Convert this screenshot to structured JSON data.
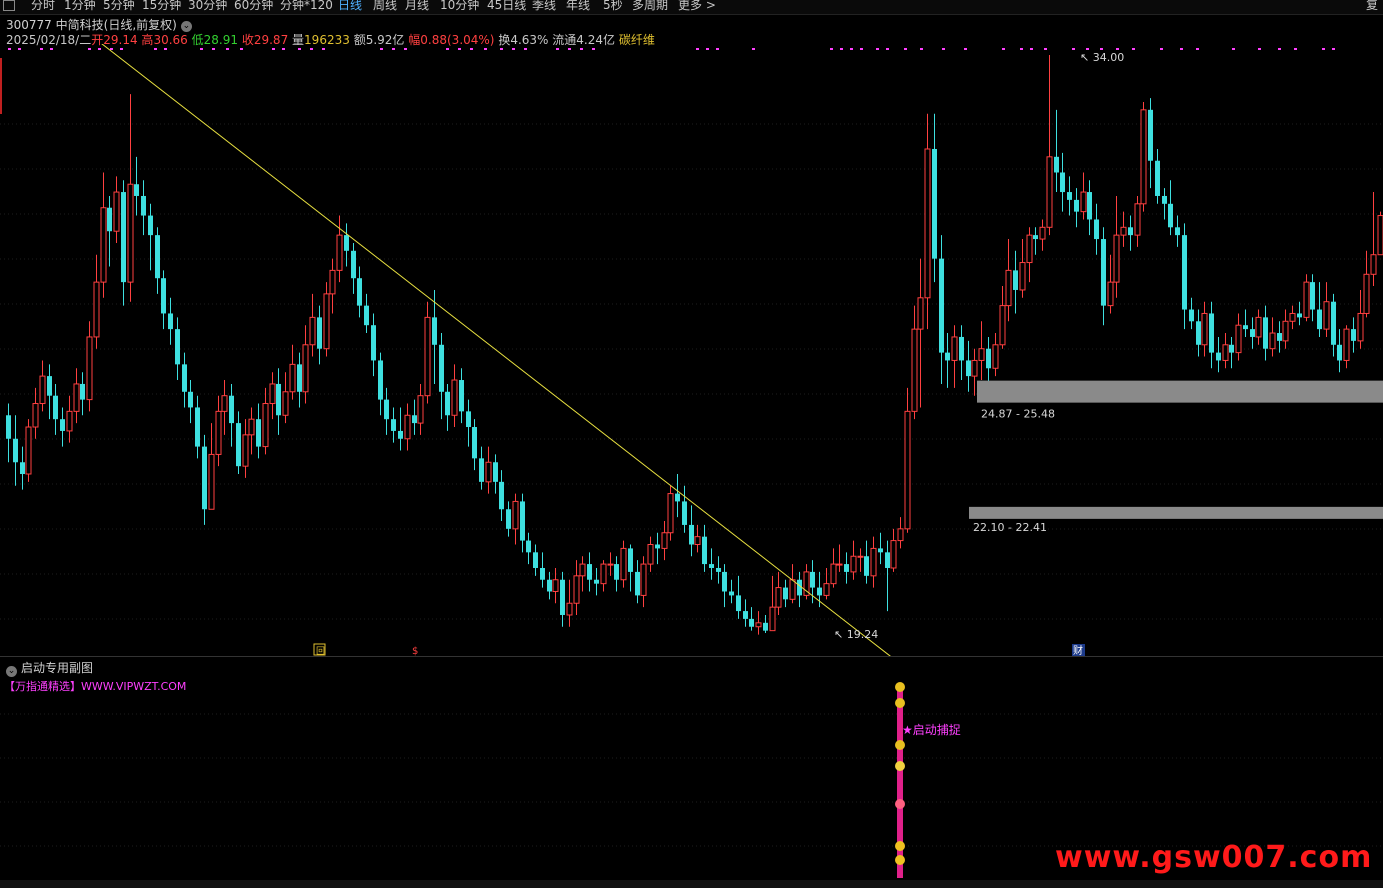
{
  "toolbar": {
    "items": [
      "分时",
      "1分钟",
      "5分钟",
      "15分钟",
      "30分钟",
      "60分钟",
      "分钟*120",
      "日线",
      "周线",
      "月线",
      "10分钟",
      "45日线",
      "季线",
      "年线",
      "5秒",
      "多周期",
      "更多 >"
    ],
    "active": "日线",
    "right_label": "复"
  },
  "title": {
    "code": "300777",
    "name": "中简科技",
    "mode": "(日线,前复权)"
  },
  "info": {
    "date": "2025/02/18/二",
    "open_label": "开",
    "open": "29.14",
    "high_label": "高",
    "high": "30.66",
    "low_label": "低",
    "low": "28.91",
    "close_label": "收",
    "close": "29.87",
    "volume_label": "量",
    "volume": "196233",
    "amount_label": "额",
    "amount": "5.92亿",
    "change_label": "幅",
    "change": "0.88(3.04%)",
    "turnover_label": "换",
    "turnover": "4.63%",
    "float_label": "流通",
    "float": "4.24亿",
    "concept": "碳纤维"
  },
  "chart_data": {
    "type": "candlestick",
    "series_note": "",
    "price_range": [
      17.5,
      35.5
    ],
    "max_label": "34.00",
    "min_label": "19.24",
    "zones": [
      {
        "label": "24.87 - 25.48",
        "low": 24.87,
        "high": 25.48
      },
      {
        "label": "22.10 - 22.41",
        "low": 22.1,
        "high": 22.41
      }
    ],
    "trendline": {
      "from": 34.6,
      "to": 18.0
    },
    "markers": {
      "back": "回",
      "dollar": "$",
      "finance": "财"
    },
    "candles": [
      [
        24.8,
        24.2,
        25.1,
        23.6
      ],
      [
        24.2,
        23.6,
        24.8,
        23.0
      ],
      [
        23.6,
        23.3,
        24.0,
        22.9
      ],
      [
        23.3,
        24.5,
        24.7,
        23.1
      ],
      [
        24.5,
        25.1,
        25.5,
        24.2
      ],
      [
        25.1,
        25.8,
        26.2,
        24.9
      ],
      [
        25.8,
        25.3,
        26.1,
        24.7
      ],
      [
        25.3,
        24.7,
        25.6,
        24.3
      ],
      [
        24.7,
        24.4,
        25.0,
        24.0
      ],
      [
        24.4,
        24.9,
        25.3,
        24.1
      ],
      [
        24.9,
        25.6,
        26.0,
        24.6
      ],
      [
        25.6,
        25.2,
        25.9,
        24.8
      ],
      [
        25.2,
        26.8,
        27.2,
        24.9
      ],
      [
        26.8,
        28.2,
        28.9,
        26.5
      ],
      [
        28.2,
        30.1,
        31.0,
        27.8
      ],
      [
        30.1,
        29.5,
        30.4,
        28.6
      ],
      [
        29.5,
        30.5,
        30.9,
        29.2
      ],
      [
        30.5,
        28.2,
        30.8,
        27.6
      ],
      [
        28.2,
        30.7,
        33.0,
        27.7
      ],
      [
        30.7,
        30.4,
        31.4,
        29.9
      ],
      [
        30.4,
        29.9,
        30.8,
        29.4
      ],
      [
        29.9,
        29.4,
        30.2,
        28.5
      ],
      [
        29.4,
        28.3,
        29.6,
        27.9
      ],
      [
        28.3,
        27.4,
        28.5,
        27.0
      ],
      [
        27.4,
        27.0,
        27.8,
        26.6
      ],
      [
        27.0,
        26.1,
        27.3,
        25.7
      ],
      [
        26.1,
        25.4,
        26.4,
        25.0
      ],
      [
        25.4,
        25.0,
        25.7,
        24.6
      ],
      [
        25.0,
        24.0,
        25.3,
        23.7
      ],
      [
        24.0,
        22.4,
        24.3,
        22.0
      ],
      [
        22.4,
        23.8,
        24.6,
        22.8
      ],
      [
        23.8,
        24.9,
        25.3,
        23.5
      ],
      [
        24.9,
        25.3,
        25.7,
        24.3
      ],
      [
        25.3,
        24.6,
        25.6,
        24.0
      ],
      [
        24.6,
        23.5,
        24.9,
        23.3
      ],
      [
        23.5,
        24.3,
        24.7,
        23.2
      ],
      [
        24.3,
        24.7,
        25.0,
        23.8
      ],
      [
        24.7,
        24.0,
        25.1,
        23.7
      ],
      [
        24.0,
        25.1,
        25.5,
        23.8
      ],
      [
        25.1,
        25.6,
        25.9,
        24.7
      ],
      [
        25.6,
        24.8,
        26.0,
        24.3
      ],
      [
        24.8,
        25.4,
        25.9,
        24.6
      ],
      [
        25.4,
        26.1,
        26.6,
        25.2
      ],
      [
        26.1,
        25.4,
        26.4,
        25.0
      ],
      [
        25.4,
        26.6,
        27.1,
        25.1
      ],
      [
        26.6,
        27.3,
        27.9,
        26.3
      ],
      [
        27.3,
        26.5,
        27.6,
        26.1
      ],
      [
        26.5,
        27.9,
        28.2,
        26.3
      ],
      [
        27.9,
        28.5,
        28.8,
        27.4
      ],
      [
        28.5,
        29.4,
        29.9,
        28.2
      ],
      [
        29.4,
        29.0,
        29.7,
        28.6
      ],
      [
        29.0,
        28.3,
        29.2,
        27.9
      ],
      [
        28.3,
        27.6,
        28.6,
        27.3
      ],
      [
        27.6,
        27.1,
        27.9,
        26.9
      ],
      [
        27.1,
        26.2,
        27.4,
        25.8
      ],
      [
        26.2,
        25.2,
        26.4,
        24.8
      ],
      [
        25.2,
        24.7,
        25.5,
        24.3
      ],
      [
        24.7,
        24.4,
        25.0,
        24.1
      ],
      [
        24.4,
        24.2,
        25.0,
        23.9
      ],
      [
        24.2,
        24.8,
        25.1,
        23.9
      ],
      [
        24.8,
        24.6,
        25.2,
        24.3
      ],
      [
        24.6,
        25.3,
        25.6,
        24.3
      ],
      [
        25.3,
        27.3,
        27.7,
        25.1
      ],
      [
        27.3,
        26.6,
        28.0,
        25.6
      ],
      [
        26.6,
        25.4,
        26.9,
        24.7
      ],
      [
        25.4,
        24.8,
        25.6,
        24.4
      ],
      [
        24.8,
        25.7,
        26.1,
        24.5
      ],
      [
        25.7,
        24.9,
        26.0,
        24.6
      ],
      [
        24.9,
        24.5,
        25.2,
        24.0
      ],
      [
        24.5,
        23.7,
        24.7,
        23.4
      ],
      [
        23.7,
        23.1,
        24.0,
        22.9
      ],
      [
        23.1,
        23.6,
        24.0,
        22.8
      ],
      [
        23.6,
        23.1,
        23.8,
        22.8
      ],
      [
        23.1,
        22.4,
        23.4,
        22.1
      ],
      [
        22.4,
        21.9,
        22.6,
        21.7
      ],
      [
        21.9,
        22.6,
        22.8,
        21.5
      ],
      [
        22.6,
        21.6,
        22.8,
        21.3
      ],
      [
        21.6,
        21.3,
        21.8,
        21.0
      ],
      [
        21.3,
        20.9,
        21.5,
        20.7
      ],
      [
        20.9,
        20.6,
        21.3,
        20.4
      ],
      [
        20.6,
        20.3,
        20.8,
        20.1
      ],
      [
        20.3,
        20.6,
        20.9,
        20.0
      ],
      [
        20.6,
        19.7,
        20.8,
        19.4
      ],
      [
        19.7,
        20.0,
        20.6,
        19.4
      ],
      [
        20.0,
        20.7,
        21.1,
        19.7
      ],
      [
        20.7,
        21.0,
        21.2,
        20.3
      ],
      [
        21.0,
        20.6,
        21.3,
        20.3
      ],
      [
        20.6,
        20.5,
        20.9,
        20.2
      ],
      [
        20.5,
        21.0,
        21.1,
        20.3
      ],
      [
        21.0,
        21.0,
        21.3,
        20.7
      ],
      [
        21.0,
        20.6,
        21.2,
        20.3
      ],
      [
        20.6,
        21.4,
        21.6,
        20.4
      ],
      [
        21.4,
        20.8,
        21.5,
        20.3
      ],
      [
        20.8,
        20.2,
        21.1,
        20.0
      ],
      [
        20.2,
        21.0,
        21.2,
        19.9
      ],
      [
        21.0,
        21.5,
        21.7,
        20.8
      ],
      [
        21.5,
        21.4,
        21.8,
        21.0
      ],
      [
        21.4,
        21.8,
        22.1,
        21.1
      ],
      [
        21.8,
        22.8,
        23.0,
        21.6
      ],
      [
        22.8,
        22.6,
        23.3,
        22.2
      ],
      [
        22.6,
        22.0,
        23.0,
        21.8
      ],
      [
        22.0,
        21.5,
        22.5,
        21.2
      ],
      [
        21.5,
        21.7,
        22.0,
        21.3
      ],
      [
        21.7,
        21.0,
        22.0,
        20.8
      ],
      [
        21.0,
        20.9,
        21.4,
        20.6
      ],
      [
        20.9,
        20.8,
        21.2,
        20.5
      ],
      [
        20.8,
        20.3,
        21.0,
        19.9
      ],
      [
        20.3,
        20.2,
        20.6,
        20.0
      ],
      [
        20.2,
        19.8,
        20.7,
        19.6
      ],
      [
        19.8,
        19.6,
        20.1,
        19.4
      ],
      [
        19.6,
        19.4,
        19.9,
        19.3
      ],
      [
        19.4,
        19.5,
        19.8,
        19.2
      ],
      [
        19.5,
        19.3,
        19.7,
        19.24
      ],
      [
        19.3,
        19.9,
        20.7,
        19.3
      ],
      [
        19.9,
        20.4,
        20.8,
        19.7
      ],
      [
        20.4,
        20.1,
        20.6,
        19.9
      ],
      [
        20.1,
        20.6,
        21.0,
        20.0
      ],
      [
        20.6,
        20.2,
        20.8,
        19.9
      ],
      [
        20.2,
        20.8,
        21.0,
        20.1
      ],
      [
        20.8,
        20.4,
        21.1,
        20.0
      ],
      [
        20.4,
        20.2,
        20.8,
        19.9
      ],
      [
        20.2,
        20.5,
        20.9,
        20.1
      ],
      [
        20.5,
        21.0,
        21.4,
        20.4
      ],
      [
        21.0,
        21.0,
        21.5,
        20.8
      ],
      [
        21.0,
        20.8,
        21.3,
        20.5
      ],
      [
        20.8,
        21.2,
        21.6,
        20.6
      ],
      [
        21.2,
        21.2,
        21.4,
        20.8
      ],
      [
        21.2,
        20.7,
        21.6,
        20.5
      ],
      [
        20.7,
        21.4,
        21.7,
        20.4
      ],
      [
        21.4,
        21.3,
        21.8,
        21.0
      ],
      [
        21.3,
        20.9,
        21.6,
        19.8
      ],
      [
        20.9,
        21.6,
        21.9,
        20.8
      ],
      [
        21.6,
        21.9,
        22.2,
        21.4
      ],
      [
        21.9,
        24.9,
        25.5,
        21.8
      ],
      [
        24.9,
        27.0,
        27.6,
        24.7
      ],
      [
        27.0,
        27.8,
        28.8,
        25.0
      ],
      [
        27.8,
        31.6,
        32.5,
        27.0
      ],
      [
        31.6,
        28.8,
        32.5,
        28.2
      ],
      [
        28.8,
        26.4,
        29.4,
        25.6
      ],
      [
        26.4,
        26.2,
        26.9,
        25.5
      ],
      [
        26.2,
        26.8,
        27.1,
        25.5
      ],
      [
        26.8,
        26.2,
        27.1,
        25.7
      ],
      [
        26.2,
        25.8,
        26.7,
        25.4
      ],
      [
        25.8,
        26.2,
        26.5,
        25.3
      ],
      [
        26.2,
        26.5,
        27.2,
        25.7
      ],
      [
        26.5,
        26.0,
        26.8,
        25.5
      ],
      [
        26.0,
        26.6,
        26.9,
        25.8
      ],
      [
        26.6,
        27.6,
        28.1,
        26.5
      ],
      [
        27.6,
        28.5,
        29.3,
        27.2
      ],
      [
        28.5,
        28.0,
        29.0,
        27.4
      ],
      [
        28.0,
        28.7,
        29.3,
        27.8
      ],
      [
        28.7,
        29.4,
        29.6,
        28.2
      ],
      [
        29.4,
        29.3,
        29.6,
        28.9
      ],
      [
        29.3,
        29.6,
        29.8,
        29.0
      ],
      [
        29.6,
        31.4,
        34.0,
        29.4
      ],
      [
        31.4,
        31.0,
        32.6,
        30.5
      ],
      [
        31.0,
        30.5,
        31.5,
        30.0
      ],
      [
        30.5,
        30.3,
        30.9,
        29.9
      ],
      [
        30.3,
        30.0,
        30.6,
        29.6
      ],
      [
        30.0,
        30.5,
        31.0,
        29.8
      ],
      [
        30.5,
        29.8,
        30.8,
        29.4
      ],
      [
        29.8,
        29.3,
        30.2,
        28.9
      ],
      [
        29.3,
        27.6,
        29.6,
        27.1
      ],
      [
        27.6,
        28.2,
        28.9,
        27.4
      ],
      [
        28.2,
        29.4,
        30.4,
        27.8
      ],
      [
        29.4,
        29.6,
        30.0,
        29.1
      ],
      [
        29.6,
        29.4,
        29.9,
        29.0
      ],
      [
        29.4,
        30.2,
        30.4,
        29.1
      ],
      [
        30.2,
        32.6,
        32.8,
        30.0
      ],
      [
        32.6,
        31.3,
        32.9,
        30.6
      ],
      [
        31.3,
        30.4,
        31.6,
        30.2
      ],
      [
        30.4,
        30.2,
        30.6,
        29.8
      ],
      [
        30.2,
        29.6,
        30.8,
        29.4
      ],
      [
        29.6,
        29.4,
        29.9,
        29.1
      ],
      [
        29.4,
        27.5,
        29.7,
        27.0
      ],
      [
        27.5,
        27.2,
        27.8,
        27.0
      ],
      [
        27.2,
        26.6,
        27.5,
        26.3
      ],
      [
        26.6,
        27.4,
        27.7,
        26.3
      ],
      [
        27.4,
        26.4,
        27.7,
        26.0
      ],
      [
        26.4,
        26.2,
        26.8,
        25.9
      ],
      [
        26.2,
        26.6,
        26.9,
        26.0
      ],
      [
        26.6,
        26.4,
        26.8,
        26.0
      ],
      [
        26.4,
        27.1,
        27.4,
        26.2
      ],
      [
        27.1,
        27.0,
        27.5,
        26.8
      ],
      [
        27.0,
        26.8,
        27.3,
        26.5
      ],
      [
        26.8,
        27.3,
        27.5,
        26.6
      ],
      [
        27.3,
        26.5,
        27.6,
        26.2
      ],
      [
        26.5,
        26.9,
        27.3,
        26.3
      ],
      [
        26.9,
        26.7,
        27.2,
        26.4
      ],
      [
        26.7,
        27.2,
        27.5,
        26.5
      ],
      [
        27.2,
        27.4,
        27.6,
        27.0
      ],
      [
        27.4,
        27.3,
        27.7,
        27.1
      ],
      [
        27.3,
        28.2,
        28.4,
        27.2
      ],
      [
        28.2,
        27.5,
        28.4,
        27.2
      ],
      [
        27.5,
        27.0,
        28.2,
        26.8
      ],
      [
        27.0,
        27.7,
        28.2,
        26.8
      ],
      [
        27.7,
        26.6,
        27.9,
        26.3
      ],
      [
        26.6,
        26.2,
        27.0,
        25.9
      ],
      [
        26.2,
        27.0,
        27.1,
        26.0
      ],
      [
        27.0,
        26.7,
        27.3,
        26.4
      ],
      [
        26.7,
        27.4,
        28.0,
        26.5
      ],
      [
        27.4,
        28.4,
        29.0,
        27.3
      ],
      [
        28.4,
        28.9,
        30.5,
        28.1
      ],
      [
        28.9,
        29.9,
        30.0,
        29.0
      ]
    ]
  },
  "subchart": {
    "title": "启动专用副图",
    "promo": "【万指通精选】WWW.VIPWZT.COM",
    "signal": "启动捕捉"
  },
  "watermark": "www.gsw007.com",
  "colors": {
    "up": "#ff4040",
    "down": "#3ee0e0",
    "magenta": "#ff40ff",
    "zone": "#8a8a8a",
    "trendline": "#e8e040"
  }
}
